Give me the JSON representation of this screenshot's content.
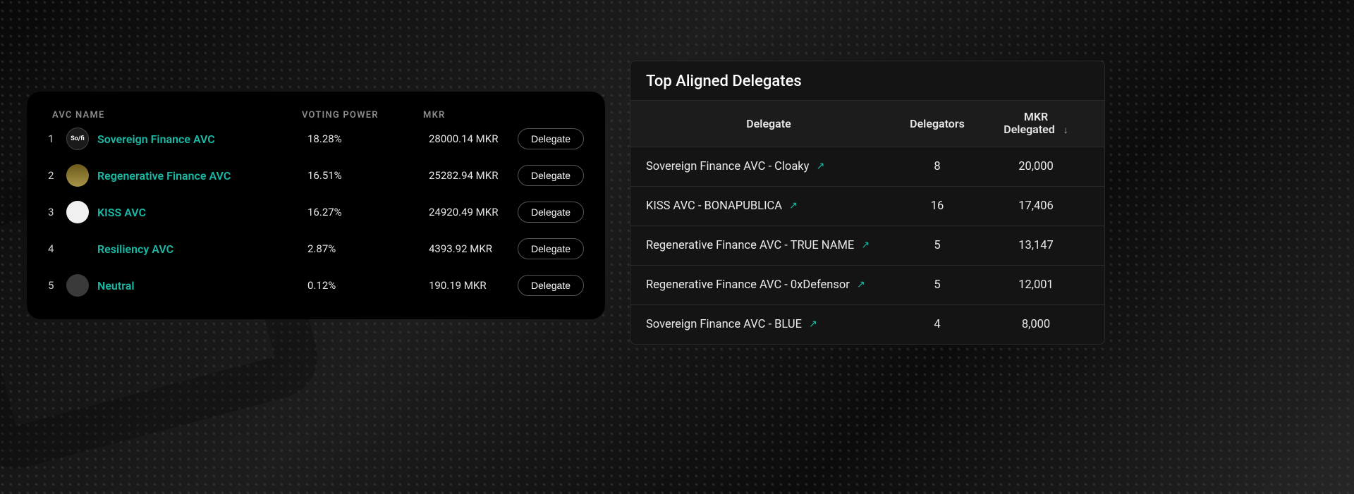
{
  "avc_table": {
    "headers": {
      "name": "AVC NAME",
      "voting_power": "VOTING POWER",
      "mkr": "MKR"
    },
    "delegate_label": "Delegate",
    "rows": [
      {
        "idx": "1",
        "name": "Sovereign Finance AVC",
        "vp": "18.28%",
        "mkr": "28000.14 MKR",
        "avatar": "sofi",
        "avatar_label": "So/fi"
      },
      {
        "idx": "2",
        "name": "Regenerative Finance AVC",
        "vp": "16.51%",
        "mkr": "25282.94 MKR",
        "avatar": "regen",
        "avatar_label": ""
      },
      {
        "idx": "3",
        "name": "KISS AVC",
        "vp": "16.27%",
        "mkr": "24920.49 MKR",
        "avatar": "kiss",
        "avatar_label": ""
      },
      {
        "idx": "4",
        "name": "Resiliency AVC",
        "vp": "2.87%",
        "mkr": "4393.92 MKR",
        "avatar": "blank",
        "avatar_label": ""
      },
      {
        "idx": "5",
        "name": "Neutral",
        "vp": "0.12%",
        "mkr": "190.19 MKR",
        "avatar": "neutral",
        "avatar_label": ""
      }
    ]
  },
  "delegates_card": {
    "title": "Top Aligned Delegates",
    "headers": {
      "delegate": "Delegate",
      "delegators": "Delegators",
      "mkr_delegated": "MKR\nDelegated"
    },
    "rows": [
      {
        "name": "Sovereign Finance AVC - Cloaky",
        "delegators": "8",
        "mkr": "20,000"
      },
      {
        "name": "KISS AVC - BONAPUBLICA",
        "delegators": "16",
        "mkr": "17,406"
      },
      {
        "name": "Regenerative Finance AVC - TRUE NAME",
        "delegators": "5",
        "mkr": "13,147"
      },
      {
        "name": "Regenerative Finance AVC - 0xDefensor",
        "delegators": "5",
        "mkr": "12,001"
      },
      {
        "name": "Sovereign Finance AVC - BLUE",
        "delegators": "4",
        "mkr": "8,000"
      }
    ]
  }
}
